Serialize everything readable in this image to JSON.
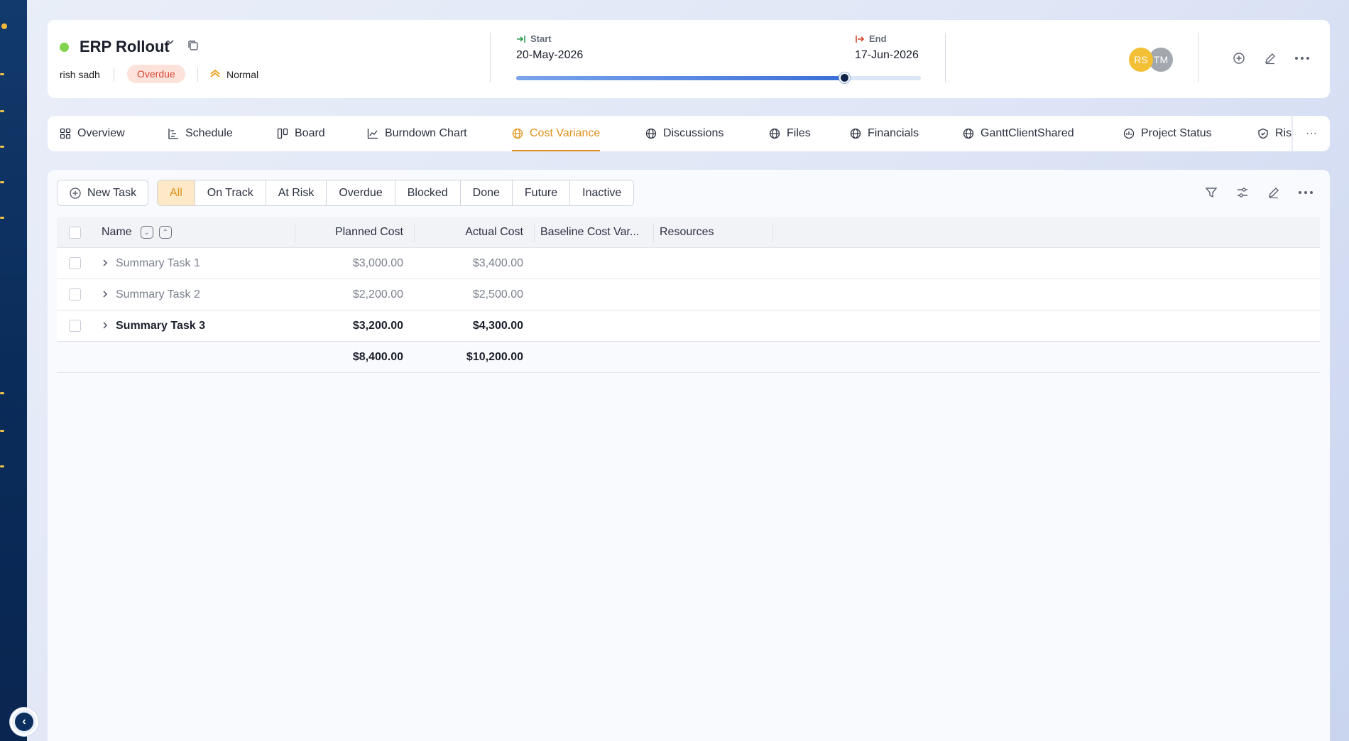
{
  "project": {
    "title": "ERP Rollout",
    "owner": "rish sadh",
    "status_badge": "Overdue",
    "priority": "Normal",
    "start_label": "Start",
    "start_date": "20-May-2026",
    "end_label": "End",
    "end_date": "17-Jun-2026",
    "progress_fraction": 0.81,
    "avatars": [
      {
        "initials": "RS",
        "color": "#f3c035"
      },
      {
        "initials": "TM",
        "color": "#a3a7ae"
      }
    ]
  },
  "tabs": [
    {
      "label": "Overview",
      "icon": "grid-icon"
    },
    {
      "label": "Schedule",
      "icon": "schedule-icon"
    },
    {
      "label": "Board",
      "icon": "board-icon"
    },
    {
      "label": "Burndown Chart",
      "icon": "chart-line-icon"
    },
    {
      "label": "Cost Variance",
      "icon": "globe-icon",
      "active": true
    },
    {
      "label": "Discussions",
      "icon": "globe-icon"
    },
    {
      "label": "Files",
      "icon": "globe-icon"
    },
    {
      "label": "Financials",
      "icon": "globe-icon"
    },
    {
      "label": "GanttClientShared",
      "icon": "globe-icon"
    },
    {
      "label": "Project Status",
      "icon": "status-icon"
    },
    {
      "label": "Ris",
      "icon": "shield-icon"
    }
  ],
  "toolbar": {
    "new_task_label": "New Task",
    "filters": [
      "All",
      "On Track",
      "At Risk",
      "Overdue",
      "Blocked",
      "Done",
      "Future",
      "Inactive"
    ],
    "active_filter": "All"
  },
  "table": {
    "columns": {
      "name": "Name",
      "planned": "Planned Cost",
      "actual": "Actual Cost",
      "baseline": "Baseline Cost Var...",
      "resources": "Resources"
    },
    "rows": [
      {
        "name": "Summary Task 1",
        "planned": "$3,000.00",
        "actual": "$3,400.00",
        "bold": false
      },
      {
        "name": "Summary Task 2",
        "planned": "$2,200.00",
        "actual": "$2,500.00",
        "bold": false
      },
      {
        "name": "Summary Task 3",
        "planned": "$3,200.00",
        "actual": "$4,300.00",
        "bold": true
      }
    ],
    "totals": {
      "planned": "$8,400.00",
      "actual": "$10,200.00"
    }
  }
}
